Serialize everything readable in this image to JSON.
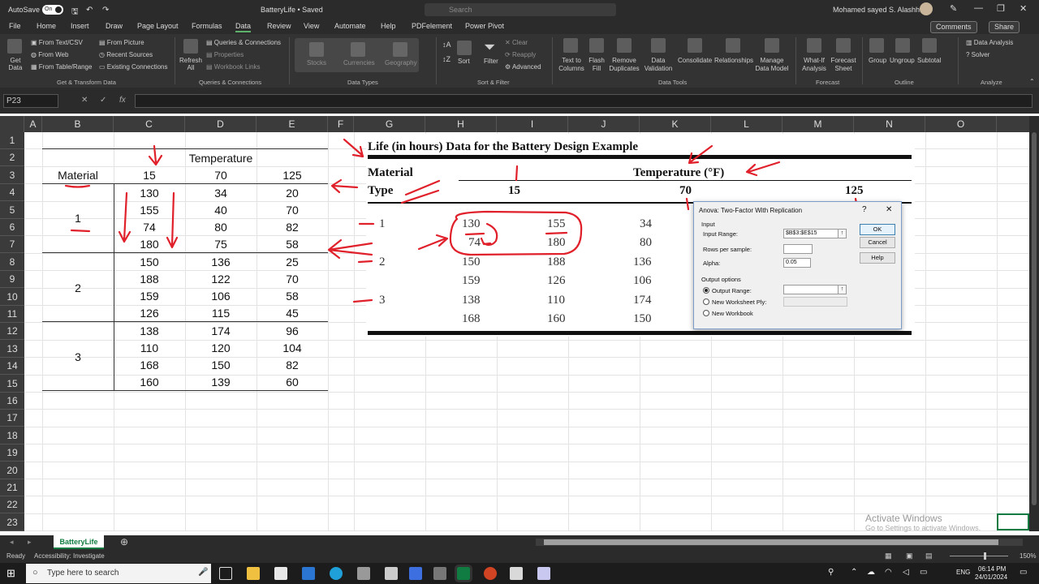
{
  "titlebar": {
    "autosave": "AutoSave",
    "autosave_state": "On",
    "doc_title": "BatteryLife • Saved",
    "search_placeholder": "Search",
    "user": "Mohamed sayed S. Alashhab"
  },
  "menu": {
    "tabs": [
      "File",
      "Home",
      "Insert",
      "Draw",
      "Page Layout",
      "Formulas",
      "Data",
      "Review",
      "View",
      "Automate",
      "Help",
      "PDFelement",
      "Power Pivot"
    ],
    "comments": "Comments",
    "share": "Share"
  },
  "ribbon": {
    "get_data": "Get Data",
    "from_text_csv": "From Text/CSV",
    "from_web": "From Web",
    "from_table_range": "From Table/Range",
    "from_picture": "From Picture",
    "recent_sources": "Recent Sources",
    "existing_connections": "Existing Connections",
    "refresh_all": "Refresh All",
    "queries_connections": "Queries & Connections",
    "properties": "Properties",
    "workbook_links": "Workbook Links",
    "stocks": "Stocks",
    "currencies": "Currencies",
    "geography": "Geography",
    "sort": "Sort",
    "filter": "Filter",
    "clear": "Clear",
    "reapply": "Reapply",
    "advanced": "Advanced",
    "text_to_columns": "Text to Columns",
    "flash_fill": "Flash Fill",
    "remove_duplicates": "Remove Duplicates",
    "data_validation": "Data Validation",
    "consolidate": "Consolidate",
    "relationships": "Relationships",
    "manage_data_model": "Manage Data Model",
    "what_if": "What-If Analysis",
    "forecast_sheet": "Forecast Sheet",
    "group": "Group",
    "ungroup": "Ungroup",
    "subtotal": "Subtotal",
    "data_analysis": "Data Analysis",
    "solver": "Solver",
    "groups": [
      "Get & Transform Data",
      "Queries & Connections",
      "Data Types",
      "Sort & Filter",
      "Data Tools",
      "Forecast",
      "Outline",
      "Analyze"
    ]
  },
  "formula": {
    "name_box": "P23",
    "fx": "fx"
  },
  "columns": [
    "A",
    "B",
    "C",
    "D",
    "E",
    "F",
    "G",
    "H",
    "I",
    "J",
    "K",
    "L",
    "M",
    "N",
    "O"
  ],
  "rows": [
    "1",
    "2",
    "3",
    "4",
    "5",
    "6",
    "7",
    "8",
    "9",
    "10",
    "11",
    "12",
    "13",
    "14",
    "15",
    "16",
    "17",
    "18",
    "19",
    "20",
    "21",
    "22",
    "23"
  ],
  "sheet": {
    "temperature": "Temperature",
    "material": "Material",
    "temps": [
      "15",
      "70",
      "125"
    ],
    "materials": [
      "1",
      "2",
      "3"
    ],
    "values": [
      [
        "130",
        "34",
        "20"
      ],
      [
        "155",
        "40",
        "70"
      ],
      [
        "74",
        "80",
        "82"
      ],
      [
        "180",
        "75",
        "58"
      ],
      [
        "150",
        "136",
        "25"
      ],
      [
        "188",
        "122",
        "70"
      ],
      [
        "159",
        "106",
        "58"
      ],
      [
        "126",
        "115",
        "45"
      ],
      [
        "138",
        "174",
        "96"
      ],
      [
        "110",
        "120",
        "104"
      ],
      [
        "168",
        "150",
        "82"
      ],
      [
        "160",
        "139",
        "60"
      ]
    ]
  },
  "book": {
    "title": "Life (in hours) Data for the Battery Design Example",
    "material": "Material",
    "type": "Type",
    "temperature": "Temperature (°F)",
    "temps": [
      "15",
      "70",
      "125"
    ],
    "materials": [
      "1",
      "2",
      "3"
    ],
    "rows": [
      [
        "130",
        "155",
        "34"
      ],
      [
        "74",
        "180",
        "80"
      ],
      [
        "150",
        "188",
        "136"
      ],
      [
        "159",
        "126",
        "106"
      ],
      [
        "138",
        "110",
        "174"
      ],
      [
        "168",
        "160",
        "150"
      ]
    ]
  },
  "dialog": {
    "title": "Anova: Two-Factor With Replication",
    "help_glyph": "?",
    "close_glyph": "✕",
    "input_section": "Input",
    "input_range_label": "Input Range:",
    "input_range_value": "$B$3:$E$15",
    "rows_per_sample_label": "Rows per sample:",
    "alpha_label": "Alpha:",
    "alpha_value": "0.05",
    "output_section": "Output options",
    "output_range": "Output Range:",
    "new_ply": "New Worksheet Ply:",
    "new_workbook": "New Workbook",
    "ok": "OK",
    "cancel": "Cancel",
    "help": "Help"
  },
  "tabs": {
    "sheet": "BatteryLife"
  },
  "status": {
    "ready": "Ready",
    "accessibility": "Accessibility: Investigate",
    "zoom": "150%"
  },
  "watermark": {
    "title": "Activate Windows",
    "sub": "Go to Settings to activate Windows."
  },
  "taskbar": {
    "search": "Type here to search",
    "lang": "ENG",
    "time": "06:14 PM",
    "date": "24/01/2024"
  },
  "colors": {
    "excel_green": "#107c41",
    "ink_red": "#e0202a",
    "dialog_border": "#7a9cc6"
  }
}
